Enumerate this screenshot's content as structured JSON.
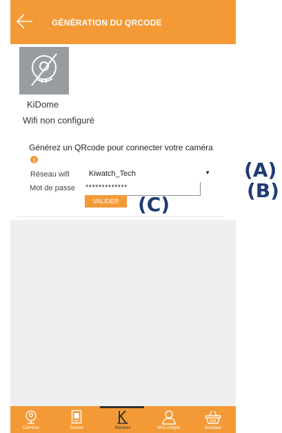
{
  "header": {
    "title": "GÉNÉRATION DU QRCODE"
  },
  "camera": {
    "name": "KiDome",
    "status": "Wifi non configuré"
  },
  "form": {
    "title": "Générez un QRcode pour connecter votre caméra",
    "wifi_label": "Réseau wifi",
    "wifi_value": "Kiwatch_Tech",
    "password_label": "Mot de passe",
    "password_value": "*************",
    "validate_label": "VALIDER"
  },
  "tabs": [
    {
      "label": "Caméras",
      "icon": "camera-icon",
      "active": false
    },
    {
      "label": "Journal",
      "icon": "journal-icon",
      "active": false
    },
    {
      "label": "Services",
      "icon": "kiwatch-k-icon",
      "active": true
    },
    {
      "label": "Mon compte",
      "icon": "account-icon",
      "active": false
    },
    {
      "label": "Boutique",
      "icon": "basket-icon",
      "active": false
    }
  ],
  "annotations": {
    "a": "(A)",
    "b": "(B)",
    "c": "(C)"
  },
  "colors": {
    "accent": "#f39a36",
    "annotation": "#1f3b73",
    "thumbnail": "#9a9da0"
  }
}
